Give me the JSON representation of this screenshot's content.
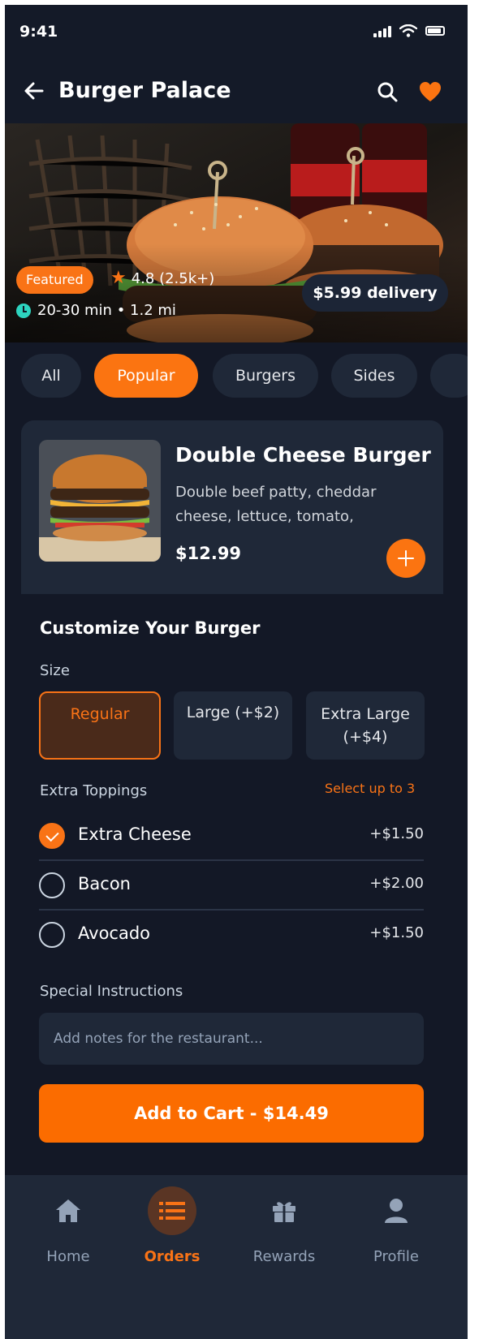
{
  "status_bar": {
    "time": "9:41"
  },
  "header": {
    "title": "Burger Palace"
  },
  "hero": {
    "badge": "Featured",
    "rating": "4.8 (2.5k+)",
    "meta": "20-30 min • 1.2 mi",
    "delivery": "$5.99 delivery"
  },
  "categories": {
    "all": "All",
    "popular": "Popular",
    "burgers": "Burgers",
    "sides": "Sides"
  },
  "item": {
    "name": "Double Cheese Burger",
    "description": "Double beef patty, cheddar cheese, lettuce, tomato,",
    "price": "$12.99"
  },
  "customize": {
    "title": "Customize Your Burger",
    "size_label": "Size",
    "sizes": {
      "regular": "Regular",
      "large": "Large (+$2)",
      "xl_line1": "Extra Large",
      "xl_line2": "(+$4)"
    },
    "toppings_label": "Extra Toppings",
    "toppings_hint": "Select up to 3",
    "toppings": {
      "cheese": {
        "name": "Extra Cheese",
        "price": "+$1.50"
      },
      "bacon": {
        "name": "Bacon",
        "price": "+$2.00"
      },
      "avocado": {
        "name": "Avocado",
        "price": "+$1.50"
      }
    },
    "instructions_label": "Special Instructions",
    "instructions_placeholder": "Add notes for the restaurant..."
  },
  "cart_button": "Add to Cart - $14.49",
  "nav": {
    "home": "Home",
    "orders": "Orders",
    "rewards": "Rewards",
    "profile": "Profile"
  },
  "colors": {
    "accent": "#fb7411",
    "background": "#131826",
    "surface": "#1f2838",
    "time_dot": "#2dd4bf"
  },
  "icons": [
    "back-arrow-icon",
    "search-icon",
    "heart-icon",
    "star-icon",
    "clock-icon",
    "plus-icon",
    "check-icon",
    "home-icon",
    "list-icon",
    "gift-icon",
    "user-icon"
  ]
}
